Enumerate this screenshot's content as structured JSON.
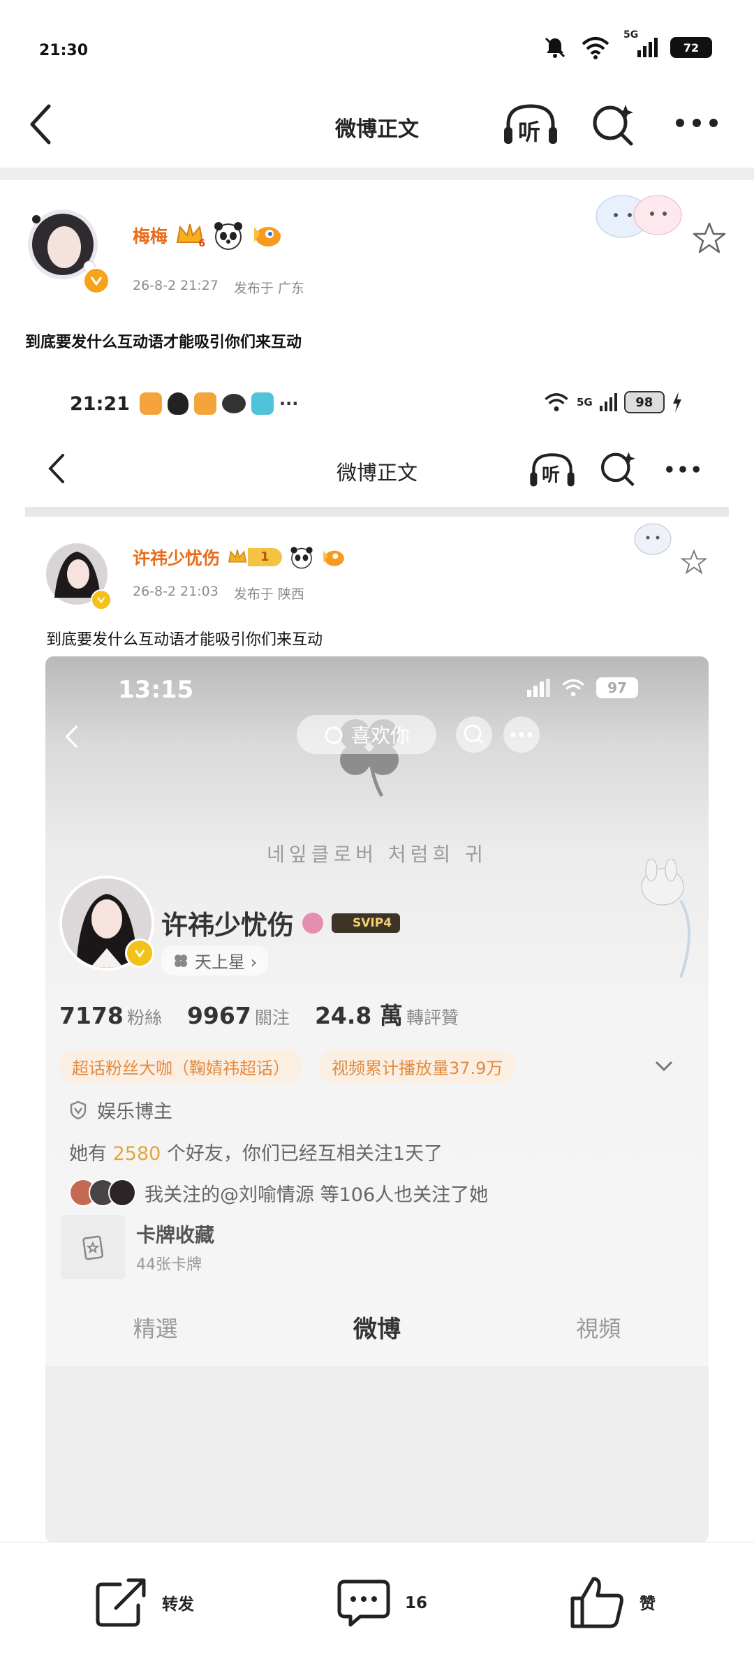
{
  "status_bar": {
    "time": "21:30",
    "signal": "5G",
    "battery": "72"
  },
  "nav": {
    "back_icon": "chevron-left-icon",
    "title": "微博正文",
    "listen_label": "听",
    "more_icon": "more-dots-icon"
  },
  "post": {
    "author": "梅梅",
    "level": "6",
    "time": "26-8-2 21:27",
    "location": "发布于 广东",
    "text": "到底要发什么互动语才能吸引你们来互动"
  },
  "embedded": {
    "status_time": "21:21",
    "signal": "5G",
    "battery": "98",
    "nav_title": "微博正文",
    "listen_label": "听",
    "post": {
      "author": "许祎少忧伤",
      "level": "1",
      "time": "26-8-2 21:03",
      "location": "发布于 陕西",
      "text": "到底要发什么互动语才能吸引你们来互动"
    },
    "screenshot": {
      "status_time": "13:15",
      "battery": "97",
      "like_button": "喜欢你",
      "banner_text": "네잎클로버 처럼희 귀",
      "profile_name": "许祎少忧伤",
      "svip": "SVIP4",
      "tag": "天上星 ›",
      "stats": [
        {
          "value": "7178",
          "label": "粉絲"
        },
        {
          "value": "9967",
          "label": "關注"
        },
        {
          "value": "24.8 萬",
          "label": "轉評贊"
        }
      ],
      "badge_left": "超话粉丝大咖（鞠婧祎超话）",
      "badge_right": "视频累计播放量37.9万",
      "verified": "娱乐博主",
      "friends_prefix": "她有 ",
      "friends_count": "2580",
      "friends_suffix": " 个好友，你们已经互相关注1天了",
      "mutual": "我关注的@刘喻情源 等106人也关注了她",
      "card_title": "卡牌收藏",
      "card_sub": "44张卡牌",
      "tabs": [
        "精選",
        "微博",
        "視頻"
      ]
    }
  },
  "bottom_bar": {
    "repost_label": "转发",
    "comment_count": "16",
    "like_label": "赞"
  },
  "colors": {
    "accent": "#e86c19",
    "gold": "#f2b21b",
    "text": "#222222",
    "muted": "#8a8a8a"
  }
}
